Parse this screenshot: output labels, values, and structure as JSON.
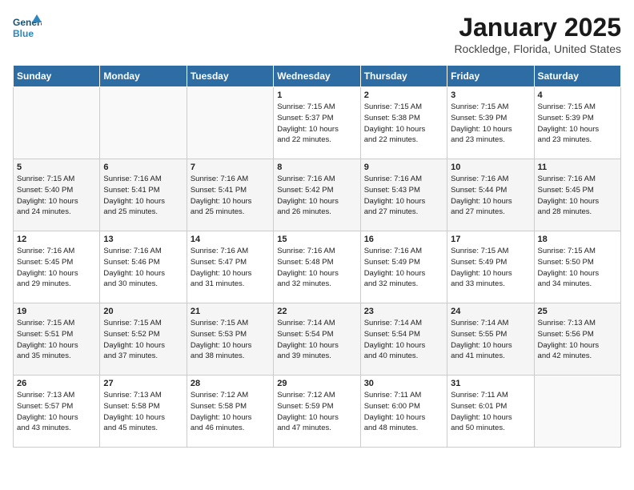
{
  "header": {
    "logo_line1": "General",
    "logo_line2": "Blue",
    "title": "January 2025",
    "subtitle": "Rockledge, Florida, United States"
  },
  "days_of_week": [
    "Sunday",
    "Monday",
    "Tuesday",
    "Wednesday",
    "Thursday",
    "Friday",
    "Saturday"
  ],
  "weeks": [
    [
      {
        "num": "",
        "info": ""
      },
      {
        "num": "",
        "info": ""
      },
      {
        "num": "",
        "info": ""
      },
      {
        "num": "1",
        "info": "Sunrise: 7:15 AM\nSunset: 5:37 PM\nDaylight: 10 hours\nand 22 minutes."
      },
      {
        "num": "2",
        "info": "Sunrise: 7:15 AM\nSunset: 5:38 PM\nDaylight: 10 hours\nand 22 minutes."
      },
      {
        "num": "3",
        "info": "Sunrise: 7:15 AM\nSunset: 5:39 PM\nDaylight: 10 hours\nand 23 minutes."
      },
      {
        "num": "4",
        "info": "Sunrise: 7:15 AM\nSunset: 5:39 PM\nDaylight: 10 hours\nand 23 minutes."
      }
    ],
    [
      {
        "num": "5",
        "info": "Sunrise: 7:15 AM\nSunset: 5:40 PM\nDaylight: 10 hours\nand 24 minutes."
      },
      {
        "num": "6",
        "info": "Sunrise: 7:16 AM\nSunset: 5:41 PM\nDaylight: 10 hours\nand 25 minutes."
      },
      {
        "num": "7",
        "info": "Sunrise: 7:16 AM\nSunset: 5:41 PM\nDaylight: 10 hours\nand 25 minutes."
      },
      {
        "num": "8",
        "info": "Sunrise: 7:16 AM\nSunset: 5:42 PM\nDaylight: 10 hours\nand 26 minutes."
      },
      {
        "num": "9",
        "info": "Sunrise: 7:16 AM\nSunset: 5:43 PM\nDaylight: 10 hours\nand 27 minutes."
      },
      {
        "num": "10",
        "info": "Sunrise: 7:16 AM\nSunset: 5:44 PM\nDaylight: 10 hours\nand 27 minutes."
      },
      {
        "num": "11",
        "info": "Sunrise: 7:16 AM\nSunset: 5:45 PM\nDaylight: 10 hours\nand 28 minutes."
      }
    ],
    [
      {
        "num": "12",
        "info": "Sunrise: 7:16 AM\nSunset: 5:45 PM\nDaylight: 10 hours\nand 29 minutes."
      },
      {
        "num": "13",
        "info": "Sunrise: 7:16 AM\nSunset: 5:46 PM\nDaylight: 10 hours\nand 30 minutes."
      },
      {
        "num": "14",
        "info": "Sunrise: 7:16 AM\nSunset: 5:47 PM\nDaylight: 10 hours\nand 31 minutes."
      },
      {
        "num": "15",
        "info": "Sunrise: 7:16 AM\nSunset: 5:48 PM\nDaylight: 10 hours\nand 32 minutes."
      },
      {
        "num": "16",
        "info": "Sunrise: 7:16 AM\nSunset: 5:49 PM\nDaylight: 10 hours\nand 32 minutes."
      },
      {
        "num": "17",
        "info": "Sunrise: 7:15 AM\nSunset: 5:49 PM\nDaylight: 10 hours\nand 33 minutes."
      },
      {
        "num": "18",
        "info": "Sunrise: 7:15 AM\nSunset: 5:50 PM\nDaylight: 10 hours\nand 34 minutes."
      }
    ],
    [
      {
        "num": "19",
        "info": "Sunrise: 7:15 AM\nSunset: 5:51 PM\nDaylight: 10 hours\nand 35 minutes."
      },
      {
        "num": "20",
        "info": "Sunrise: 7:15 AM\nSunset: 5:52 PM\nDaylight: 10 hours\nand 37 minutes."
      },
      {
        "num": "21",
        "info": "Sunrise: 7:15 AM\nSunset: 5:53 PM\nDaylight: 10 hours\nand 38 minutes."
      },
      {
        "num": "22",
        "info": "Sunrise: 7:14 AM\nSunset: 5:54 PM\nDaylight: 10 hours\nand 39 minutes."
      },
      {
        "num": "23",
        "info": "Sunrise: 7:14 AM\nSunset: 5:54 PM\nDaylight: 10 hours\nand 40 minutes."
      },
      {
        "num": "24",
        "info": "Sunrise: 7:14 AM\nSunset: 5:55 PM\nDaylight: 10 hours\nand 41 minutes."
      },
      {
        "num": "25",
        "info": "Sunrise: 7:13 AM\nSunset: 5:56 PM\nDaylight: 10 hours\nand 42 minutes."
      }
    ],
    [
      {
        "num": "26",
        "info": "Sunrise: 7:13 AM\nSunset: 5:57 PM\nDaylight: 10 hours\nand 43 minutes."
      },
      {
        "num": "27",
        "info": "Sunrise: 7:13 AM\nSunset: 5:58 PM\nDaylight: 10 hours\nand 45 minutes."
      },
      {
        "num": "28",
        "info": "Sunrise: 7:12 AM\nSunset: 5:58 PM\nDaylight: 10 hours\nand 46 minutes."
      },
      {
        "num": "29",
        "info": "Sunrise: 7:12 AM\nSunset: 5:59 PM\nDaylight: 10 hours\nand 47 minutes."
      },
      {
        "num": "30",
        "info": "Sunrise: 7:11 AM\nSunset: 6:00 PM\nDaylight: 10 hours\nand 48 minutes."
      },
      {
        "num": "31",
        "info": "Sunrise: 7:11 AM\nSunset: 6:01 PM\nDaylight: 10 hours\nand 50 minutes."
      },
      {
        "num": "",
        "info": ""
      }
    ]
  ]
}
